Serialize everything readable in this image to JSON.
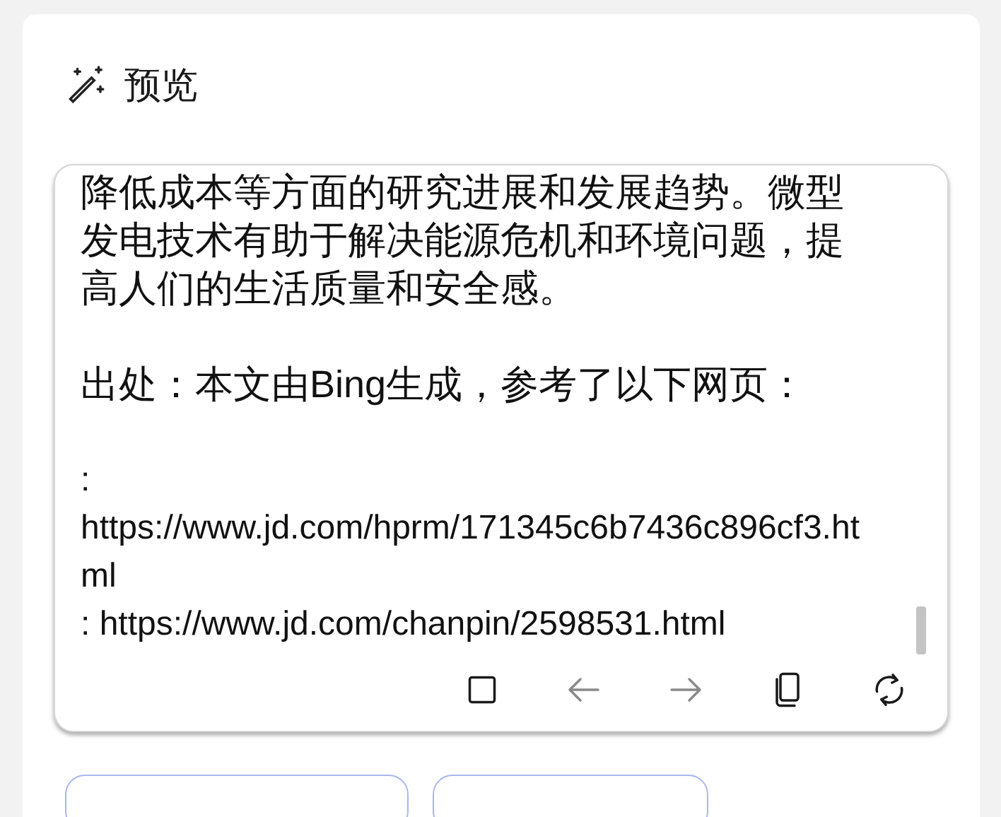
{
  "header": {
    "title": "预览"
  },
  "preview": {
    "paragraphs": [
      {
        "text": "降低成本等方面的研究进展和发展趋势。微型发电技术有助于解决能源危机和环境问题，提高人们的生活质量和安全感。"
      },
      {
        "text": "出处：本文由Bing生成，参考了以下网页："
      },
      {
        "text": ": https://www.jd.com/hprm/171345c6b7436c896cf3.html"
      },
      {
        "text": ": https://www.jd.com/chanpin/2598531.html"
      }
    ]
  },
  "toolbar": [
    {
      "kind": "stop",
      "disabled": false
    },
    {
      "kind": "back",
      "disabled": true
    },
    {
      "kind": "forward",
      "disabled": true
    },
    {
      "kind": "copy",
      "disabled": false
    },
    {
      "kind": "refresh",
      "disabled": false
    }
  ],
  "actions": [
    {
      "kind": "button"
    },
    {
      "kind": "button"
    }
  ]
}
